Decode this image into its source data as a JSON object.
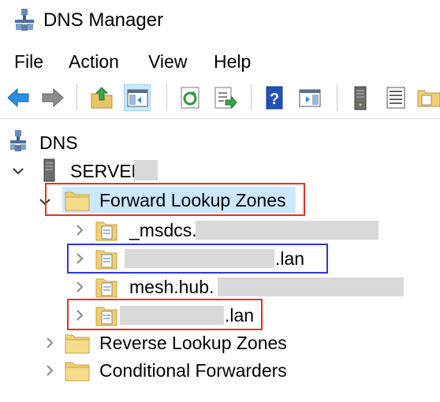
{
  "window": {
    "title": "DNS Manager"
  },
  "menu": {
    "file": "File",
    "action": "Action",
    "view": "View",
    "help": "Help"
  },
  "toolbar": {
    "buttons": [
      "back-icon",
      "forward-icon",
      "up-folder-icon",
      "show-hide-console-tree-icon",
      "refresh-icon",
      "export-list-icon",
      "help-icon",
      "show-action-pane-icon",
      "server-icon",
      "list-icon",
      "folder-icon"
    ]
  },
  "tree": {
    "root": "DNS",
    "server": "SERVER",
    "forward_lookup_zones": "Forward Lookup Zones",
    "zones": [
      {
        "prefix": "_msdcs.",
        "suffix": ""
      },
      {
        "prefix": "",
        "suffix": ".lan"
      },
      {
        "prefix": "mesh.hub.",
        "suffix": ""
      },
      {
        "prefix": "",
        "suffix": ".lan"
      }
    ],
    "reverse_lookup_zones": "Reverse Lookup Zones",
    "conditional_forwarders": "Conditional Forwarders"
  },
  "colors": {
    "highlight_red": "#e8311b",
    "highlight_blue": "#2b35e6",
    "selection": "#cce8ff",
    "redaction": "#d9d9d9"
  }
}
